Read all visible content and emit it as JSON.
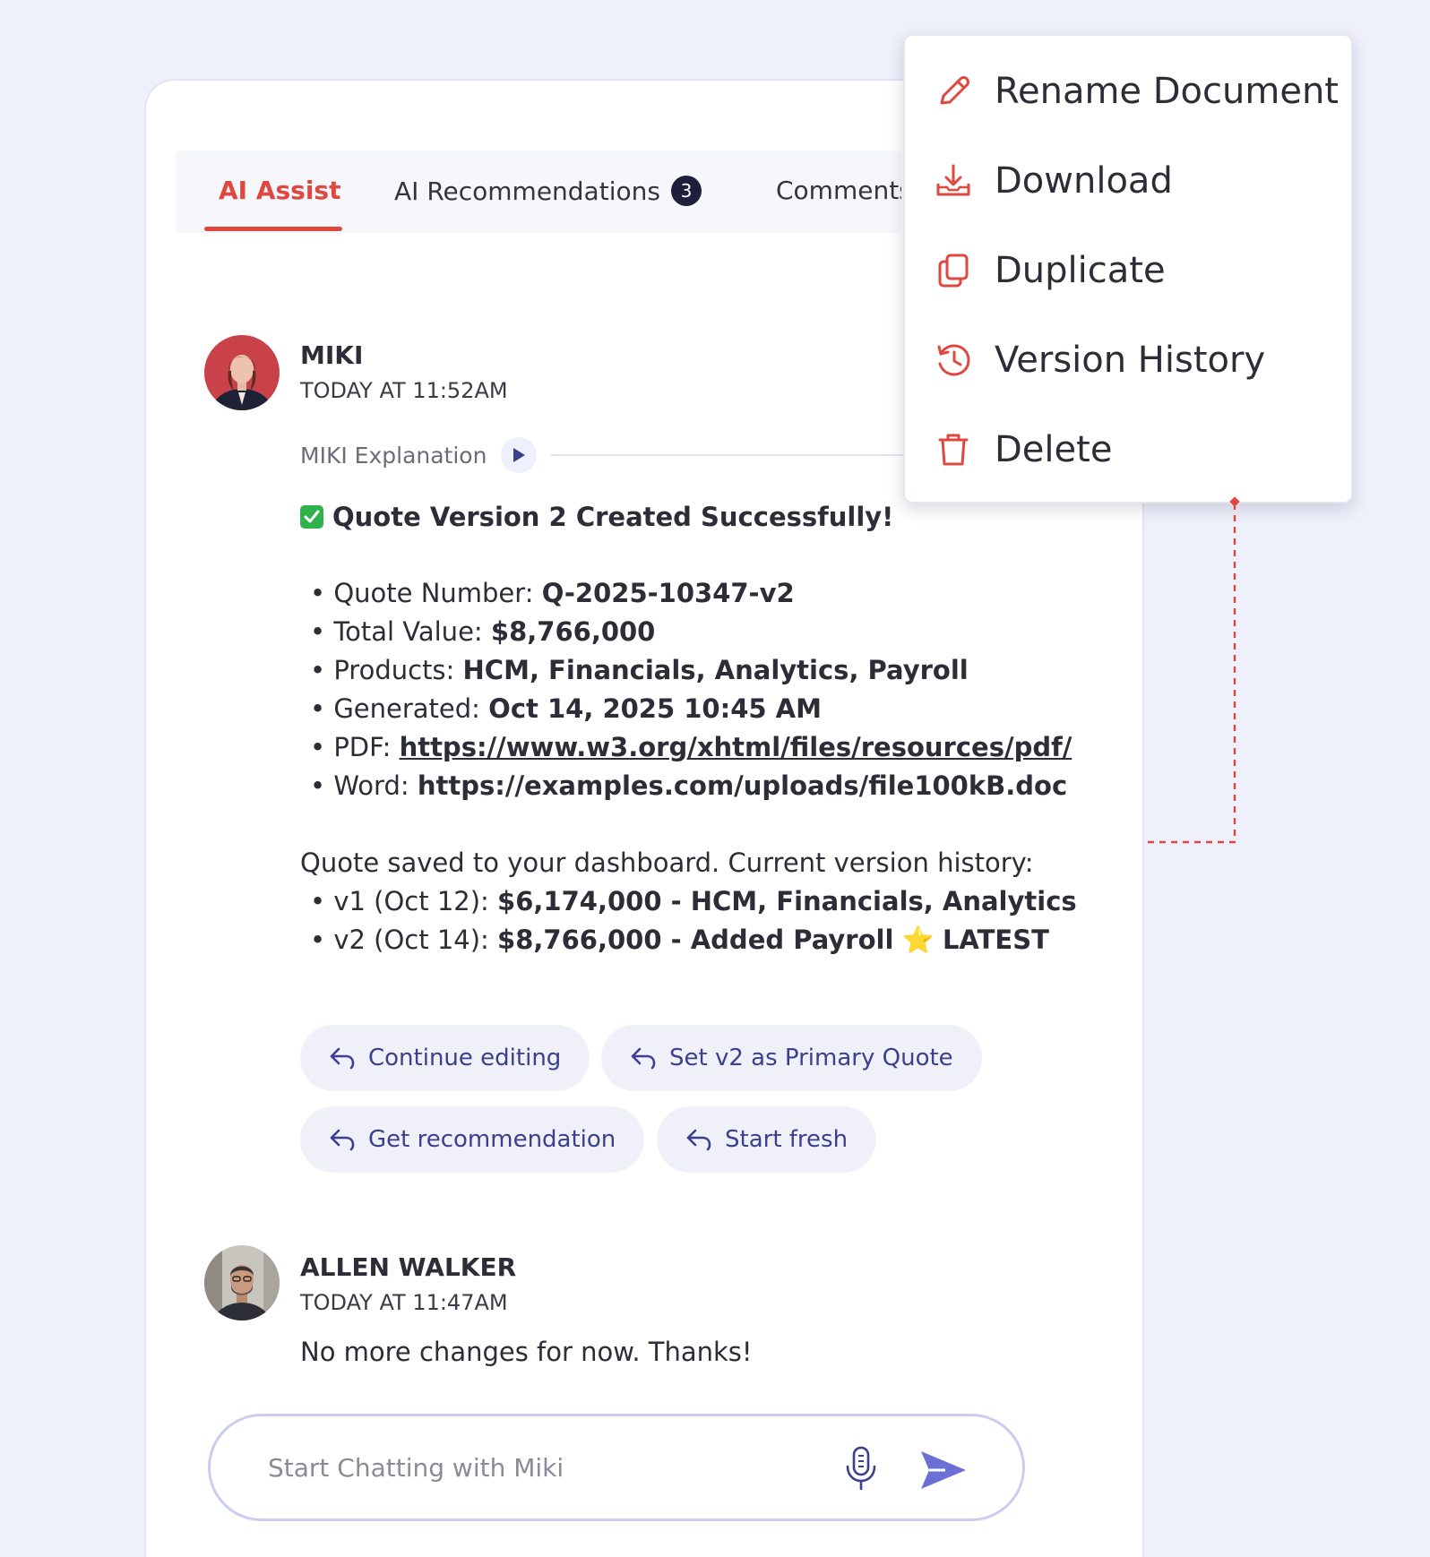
{
  "tabs": [
    {
      "label": "AI Assist",
      "active": true
    },
    {
      "label": "AI Recommendations",
      "badge": "3"
    },
    {
      "label": "Comments"
    }
  ],
  "messages": {
    "miki": {
      "name": "MIKI",
      "time": "TODAY AT 11:52AM",
      "explanation_label": "MIKI Explanation",
      "headline": "Quote Version 2 Created Successfully!",
      "details": [
        {
          "label": "• Quote Number: ",
          "value": "Q-2025-10347-v2"
        },
        {
          "label": "• Total Value: ",
          "value": "$8,766,000"
        },
        {
          "label": "• Products: ",
          "value": "HCM, Financials, Analytics, Payroll"
        },
        {
          "label": "• Generated: ",
          "value": "Oct 14, 2025 10:45 AM"
        },
        {
          "label": "• PDF: ",
          "value": "https://www.w3.org/xhtml/files/resources/pdf/"
        },
        {
          "label": "• Word: ",
          "value": "https://examples.com/uploads/file100kB.doc"
        }
      ],
      "saved_note": "Quote saved to your dashboard. Current version history:",
      "versions": [
        {
          "label": "• v1 (Oct 12): ",
          "value": "$6,174,000 - HCM, Financials, Analytics",
          "star": "",
          "suffix": ""
        },
        {
          "label": "• v2 (Oct 14): ",
          "value": "$8,766,000 - Added Payroll",
          "star": "⭐",
          "suffix": "LATEST"
        }
      ],
      "quick_replies": [
        "Continue editing",
        "Set v2 as Primary Quote",
        "Get recommendation",
        "Start fresh"
      ]
    },
    "allen": {
      "name": "ALLEN WALKER",
      "time": "TODAY AT 11:47AM",
      "text": "No more changes for now. Thanks!"
    }
  },
  "chat": {
    "placeholder": "Start Chatting with Miki",
    "icons": {
      "mic": "microphone-icon",
      "send": "send-icon"
    }
  },
  "menu": {
    "items": [
      {
        "label": "Rename Document",
        "icon": "pencil-icon"
      },
      {
        "label": "Download",
        "icon": "download-icon"
      },
      {
        "label": "Duplicate",
        "icon": "duplicate-icon"
      },
      {
        "label": "Version History",
        "icon": "history-icon"
      },
      {
        "label": "Delete",
        "icon": "trash-icon"
      }
    ]
  },
  "colors": {
    "accent": "#e0473f",
    "chip_text": "#3a3f8f",
    "send": "#6b6fd6",
    "background": "#eef0fb"
  }
}
